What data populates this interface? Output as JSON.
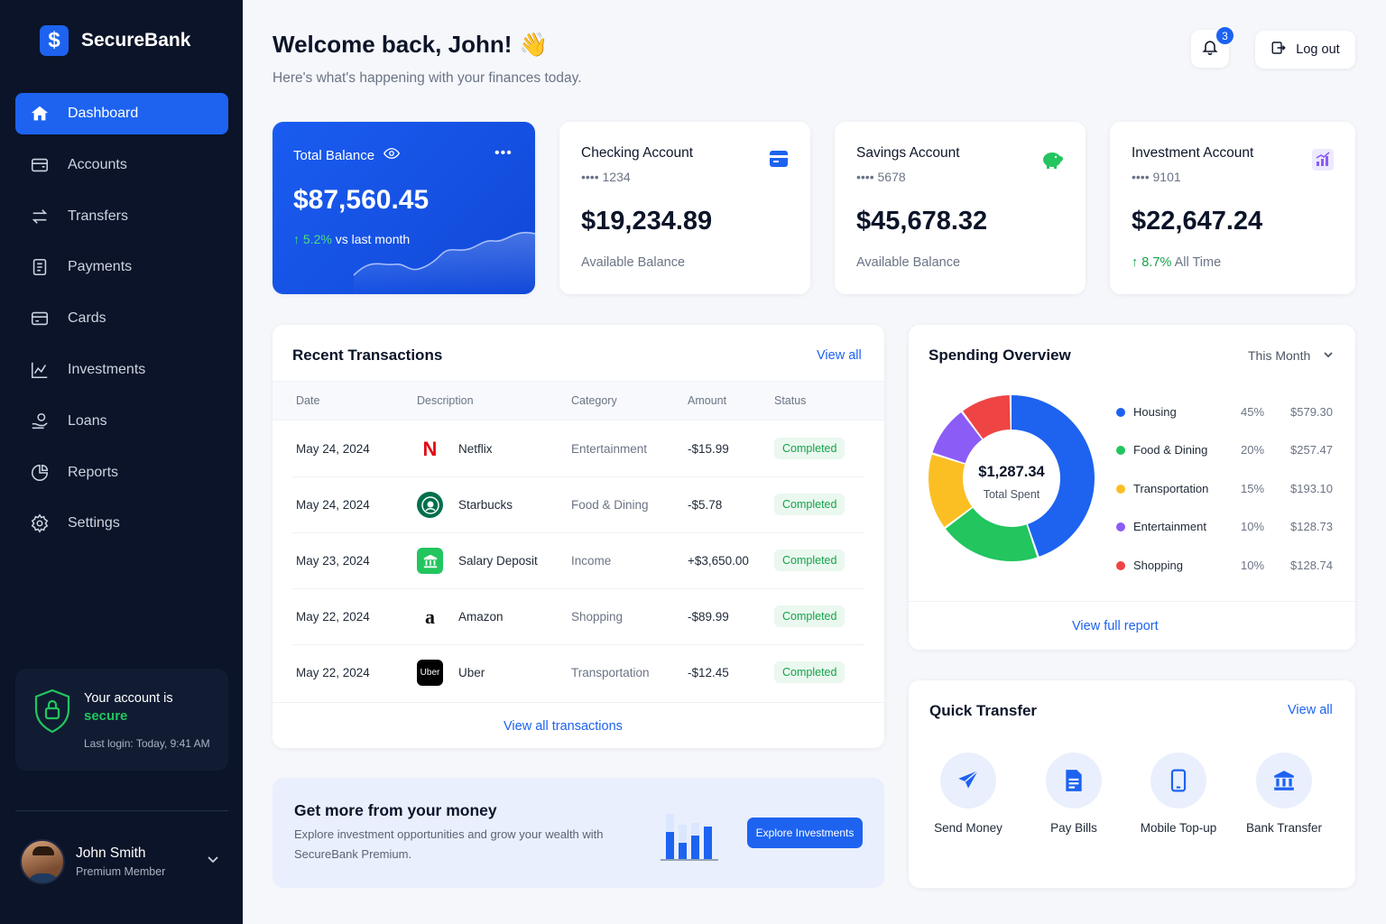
{
  "brand": {
    "name": "SecureBank",
    "logo_glyph": "$"
  },
  "sidebar": {
    "items": [
      {
        "label": "Dashboard",
        "icon": "home-icon",
        "active": true
      },
      {
        "label": "Accounts",
        "icon": "wallet-icon"
      },
      {
        "label": "Transfers",
        "icon": "arrows-icon"
      },
      {
        "label": "Payments",
        "icon": "receipt-icon"
      },
      {
        "label": "Cards",
        "icon": "credit-card-icon"
      },
      {
        "label": "Investments",
        "icon": "line-chart-icon"
      },
      {
        "label": "Loans",
        "icon": "hand-coin-icon"
      },
      {
        "label": "Reports",
        "icon": "pie-chart-icon"
      },
      {
        "label": "Settings",
        "icon": "gear-icon"
      }
    ],
    "security": {
      "title": "Your account is",
      "status": "secure",
      "last_login": "Last login: Today, 9:41 AM"
    },
    "user": {
      "name": "John Smith",
      "role": "Premium Member"
    }
  },
  "header": {
    "welcome": "Welcome back, John!",
    "wave_emoji": "👋",
    "subtitle": "Here's what's happening with your finances today.",
    "notifications": "3",
    "logout_label": "Log out"
  },
  "total_balance": {
    "label": "Total Balance",
    "amount": "$87,560.45",
    "change_pct": "5.2%",
    "change_text": "vs last month"
  },
  "accounts": [
    {
      "title": "Checking Account",
      "number": "•••• 1234",
      "amount": "$19,234.89",
      "foot": "Available Balance",
      "icon": "card-icon",
      "color": "#1d63f0"
    },
    {
      "title": "Savings Account",
      "number": "•••• 5678",
      "amount": "$45,678.32",
      "foot": "Available Balance",
      "icon": "piggy-bank-icon",
      "color": "#22c55e"
    },
    {
      "title": "Investment Account",
      "number": "•••• 9101",
      "amount": "$22,647.24",
      "foot_pct": "8.7%",
      "foot": "All Time",
      "icon": "chart-up-icon",
      "color": "#8b5cf6"
    }
  ],
  "transactions": {
    "title": "Recent Transactions",
    "view_all": "View all",
    "columns": [
      "Date",
      "Description",
      "Category",
      "Amount",
      "Status"
    ],
    "rows": [
      {
        "date": "May 24, 2024",
        "description": "Netflix",
        "category": "Entertainment",
        "amount": "-$15.99",
        "status": "Completed",
        "logo": "N",
        "logo_icon": "netflix-logo-icon"
      },
      {
        "date": "May 24, 2024",
        "description": "Starbucks",
        "category": "Food & Dining",
        "amount": "-$5.78",
        "status": "Completed",
        "logo": "",
        "logo_icon": "starbucks-logo-icon"
      },
      {
        "date": "May 23, 2024",
        "description": "Salary Deposit",
        "category": "Income",
        "amount": "+$3,650.00",
        "status": "Completed",
        "logo": "🏛",
        "logo_icon": "bank-building-icon"
      },
      {
        "date": "May 22, 2024",
        "description": "Amazon",
        "category": "Shopping",
        "amount": "-$89.99",
        "status": "Completed",
        "logo": "a",
        "logo_icon": "amazon-logo-icon"
      },
      {
        "date": "May 22, 2024",
        "description": "Uber",
        "category": "Transportation",
        "amount": "-$12.45",
        "status": "Completed",
        "logo": "Uber",
        "logo_icon": "uber-logo-icon"
      }
    ],
    "view_all_transactions": "View all transactions"
  },
  "promo": {
    "title": "Get more from your money",
    "text": "Explore investment opportunities and grow your wealth with SecureBank Premium.",
    "button": "Explore Investments"
  },
  "spending": {
    "title": "Spending Overview",
    "period": "This Month",
    "total": "$1,287.34",
    "total_label": "Total Spent",
    "categories": [
      {
        "name": "Housing",
        "pct": "45%",
        "amount": "$579.30",
        "value": 45,
        "color": "#1d63f0"
      },
      {
        "name": "Food & Dining",
        "pct": "20%",
        "amount": "$257.47",
        "value": 20,
        "color": "#22c55e"
      },
      {
        "name": "Transportation",
        "pct": "15%",
        "amount": "$193.10",
        "value": 15,
        "color": "#fbbf24"
      },
      {
        "name": "Entertainment",
        "pct": "10%",
        "amount": "$128.73",
        "value": 10,
        "color": "#8b5cf6"
      },
      {
        "name": "Shopping",
        "pct": "10%",
        "amount": "$128.74",
        "value": 10,
        "color": "#ef4444"
      }
    ],
    "view_full": "View full report"
  },
  "quick_transfer": {
    "title": "Quick Transfer",
    "view_all": "View all",
    "actions": [
      {
        "label": "Send Money",
        "icon": "paper-plane-icon"
      },
      {
        "label": "Pay Bills",
        "icon": "bill-icon"
      },
      {
        "label": "Mobile Top-up",
        "icon": "phone-icon"
      },
      {
        "label": "Bank Transfer",
        "icon": "bank-icon"
      }
    ]
  }
}
